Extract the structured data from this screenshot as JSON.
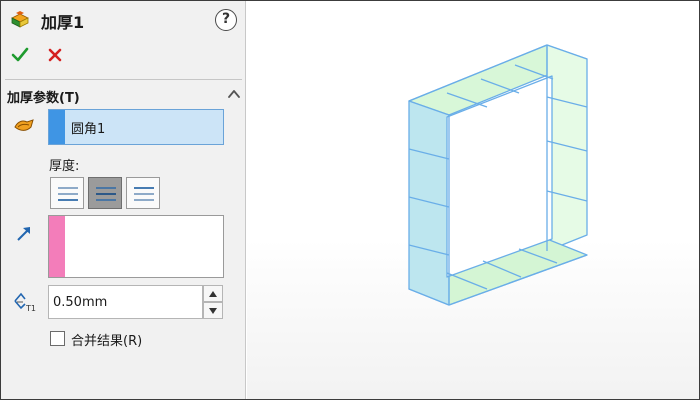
{
  "feature": {
    "title": "加厚1"
  },
  "panel": {
    "help_label": "?",
    "section_title": "加厚参数(T)",
    "face_selection": {
      "items": [
        "圆角1"
      ]
    },
    "thickness_label": "厚度:",
    "thickness_options": [
      "side-1",
      "both-sides",
      "side-2"
    ],
    "thickness_selected": "both-sides",
    "thickness_value": "0.50mm",
    "merge_result_label": "合并结果(R)",
    "merge_result_checked": false
  },
  "icons": {
    "title": "thicken-feature-icon",
    "ok": "check-icon",
    "cancel": "x-icon",
    "collapse": "chevron-up-icon",
    "face": "face-selection-icon",
    "direction": "direction-arrow-icon",
    "thickness": "thickness-icon"
  },
  "colors": {
    "ok": "#1e9b2e",
    "cancel": "#d42020",
    "face_bar": "#3f95e4",
    "direction_bar": "#f37dba",
    "selection_fill": "#cce4f7",
    "model_edge": "#6aaee8",
    "model_face_green": "#d8f7d8",
    "model_face_cyan": "#bde6ef"
  }
}
